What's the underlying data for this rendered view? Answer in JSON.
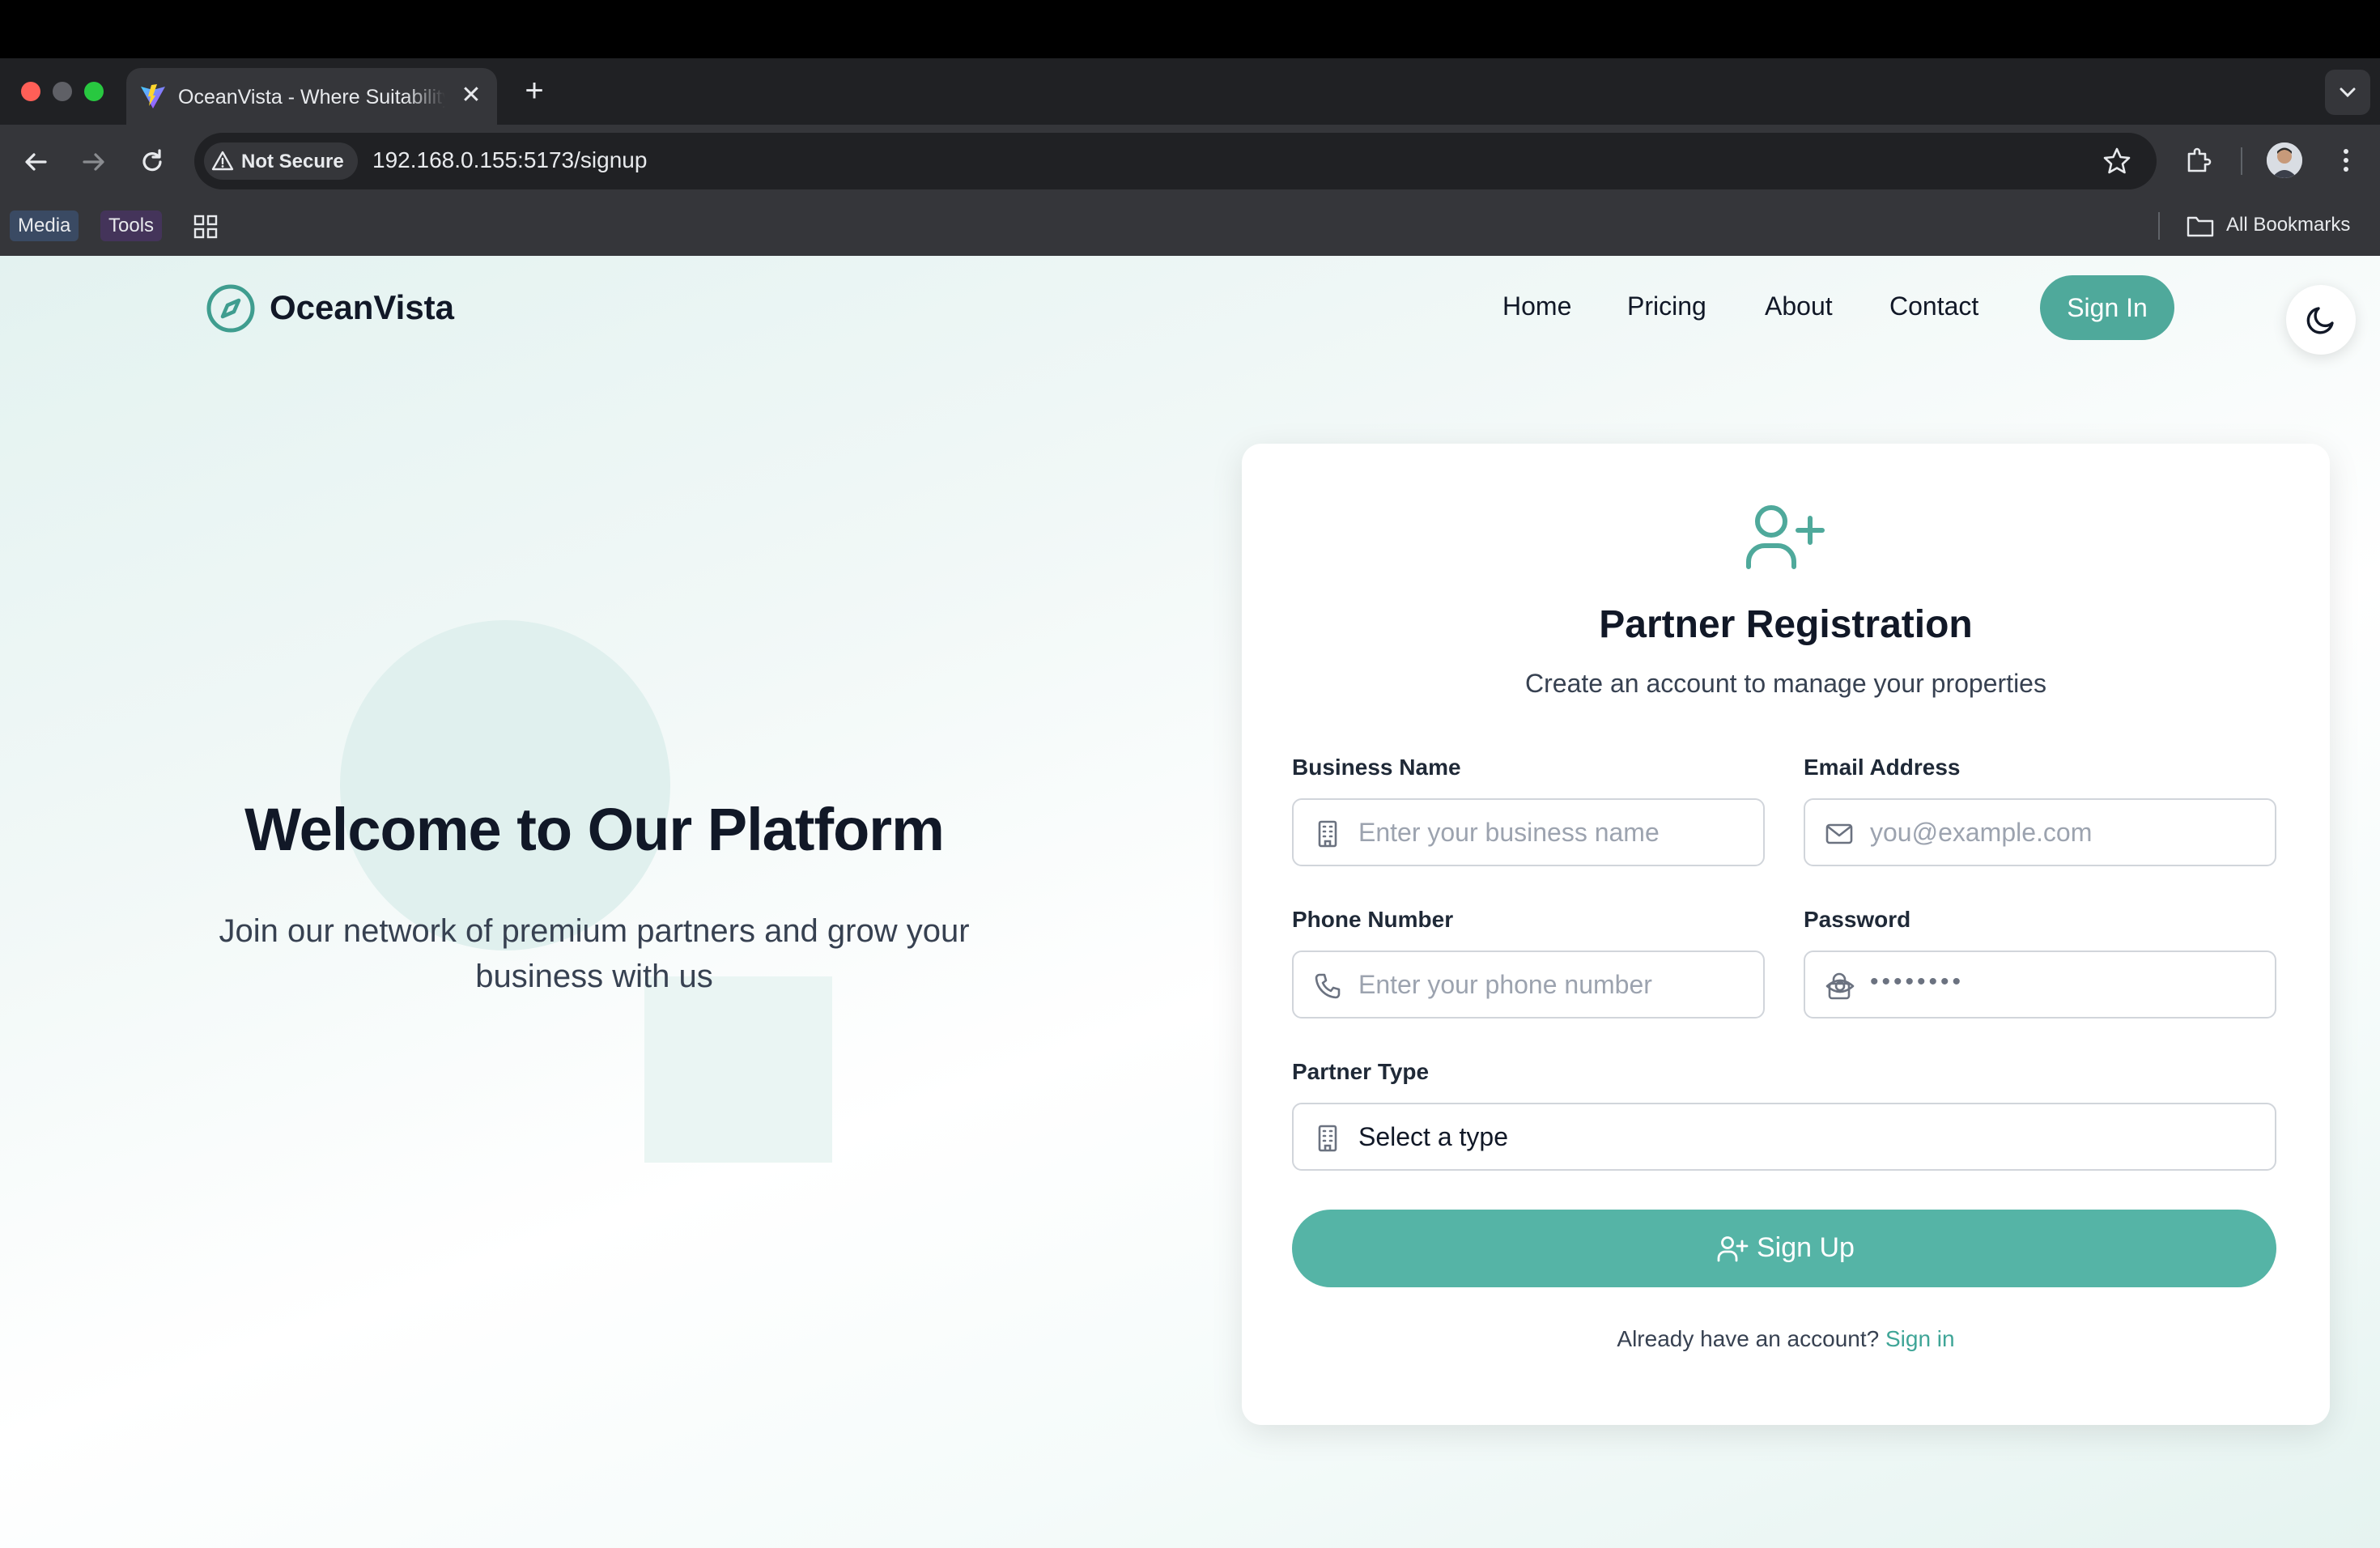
{
  "browser": {
    "tab_title": "OceanVista - Where Suitability",
    "security_label": "Not Secure",
    "url": "192.168.0.155:5173/signup",
    "bookmarks": [
      {
        "label": "Media",
        "color": "#3a4a63"
      },
      {
        "label": "Tools",
        "color": "#44345a"
      }
    ],
    "all_bookmarks_label": "All Bookmarks"
  },
  "header": {
    "brand": "OceanVista",
    "nav": [
      "Home",
      "Pricing",
      "About",
      "Contact"
    ],
    "signin_label": "Sign In",
    "theme_icon": "moon-icon"
  },
  "hero": {
    "title": "Welcome to Our Platform",
    "subtitle": "Join our network of premium partners and grow your business with us"
  },
  "form": {
    "title": "Partner Registration",
    "subtitle": "Create an account to manage your properties",
    "fields": {
      "business_name": {
        "label": "Business Name",
        "placeholder": "Enter your business name",
        "icon": "building-icon"
      },
      "email": {
        "label": "Email Address",
        "placeholder": "you@example.com",
        "icon": "mail-icon"
      },
      "phone": {
        "label": "Phone Number",
        "placeholder": "Enter your phone number",
        "icon": "phone-icon"
      },
      "password": {
        "label": "Password",
        "value": "••••••••",
        "icon": "lock-icon"
      },
      "partner_type": {
        "label": "Partner Type",
        "value": "Select a type",
        "icon": "building-icon"
      }
    },
    "submit_label": "Sign Up",
    "signin_prompt": "Already have an account?",
    "signin_link": "Sign in"
  },
  "colors": {
    "accent": "#4fa99b",
    "accent_button": "#55b4a6",
    "text_dark": "#111827"
  }
}
